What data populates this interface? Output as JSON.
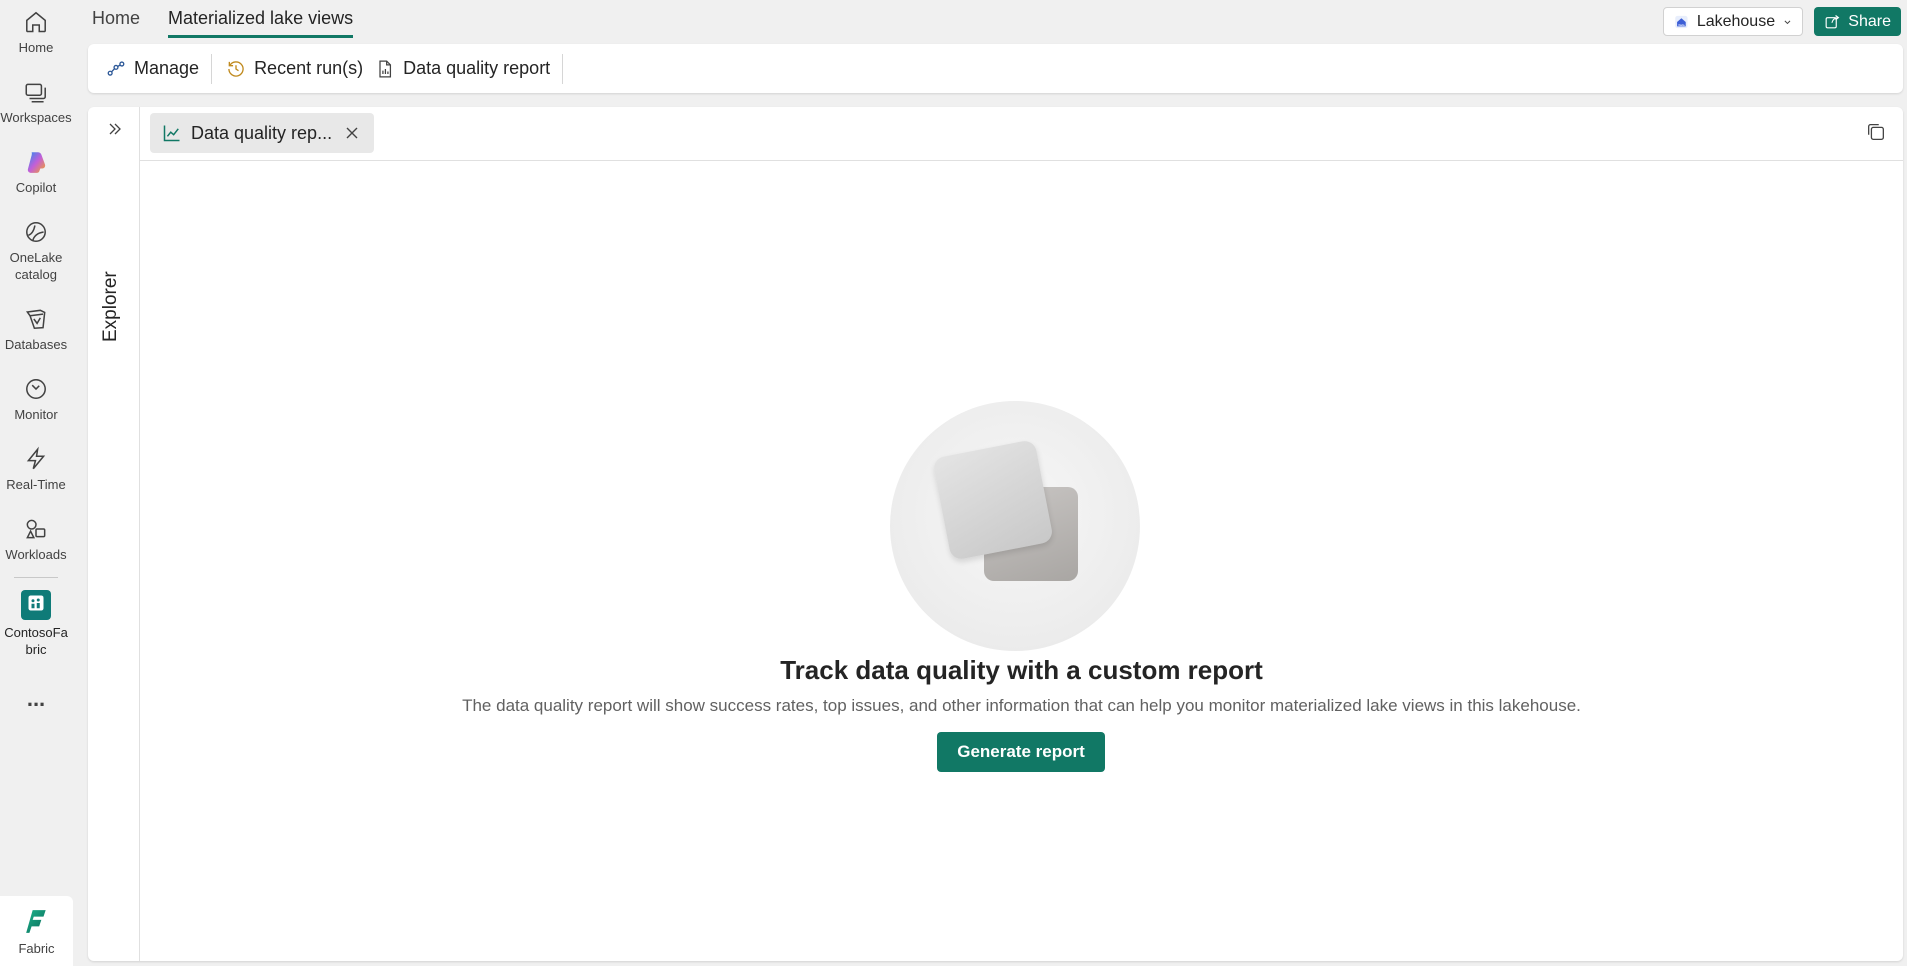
{
  "rail": {
    "items": [
      {
        "label": "Home",
        "icon": "home-icon"
      },
      {
        "label": "Workspaces",
        "icon": "workspaces-icon"
      },
      {
        "label": "Copilot",
        "icon": "copilot-icon"
      },
      {
        "label": "OneLake catalog",
        "icon": "onelake-catalog-icon"
      },
      {
        "label": "Databases",
        "icon": "databases-icon"
      },
      {
        "label": "Monitor",
        "icon": "monitor-icon"
      },
      {
        "label": "Real-Time",
        "icon": "real-time-icon"
      },
      {
        "label": "Workloads",
        "icon": "workloads-icon"
      }
    ],
    "workspace_label": "ContosoFabric",
    "more_label": "...",
    "fabric_label": "Fabric"
  },
  "topnav": {
    "tabs": [
      "Home",
      "Materialized lake views"
    ],
    "active_tab": "Materialized lake views"
  },
  "toolbar": {
    "lakehouse_label": "Lakehouse",
    "share_label": "Share"
  },
  "ribbon": {
    "items": [
      "Manage",
      "Recent run(s)",
      "Data quality report"
    ]
  },
  "explorer": {
    "label": "Explorer"
  },
  "doc_tab": {
    "label": "Data quality rep..."
  },
  "empty_state": {
    "title": "Track data quality with a custom report",
    "description": "The data quality report will show success rates, top issues, and other information that can help you monitor materialized lake views in this lakehouse.",
    "button_label": "Generate report"
  },
  "colors": {
    "accent": "#117865",
    "rail_background": "#f0f0f0",
    "workspace_icon": "#0f7b78"
  }
}
